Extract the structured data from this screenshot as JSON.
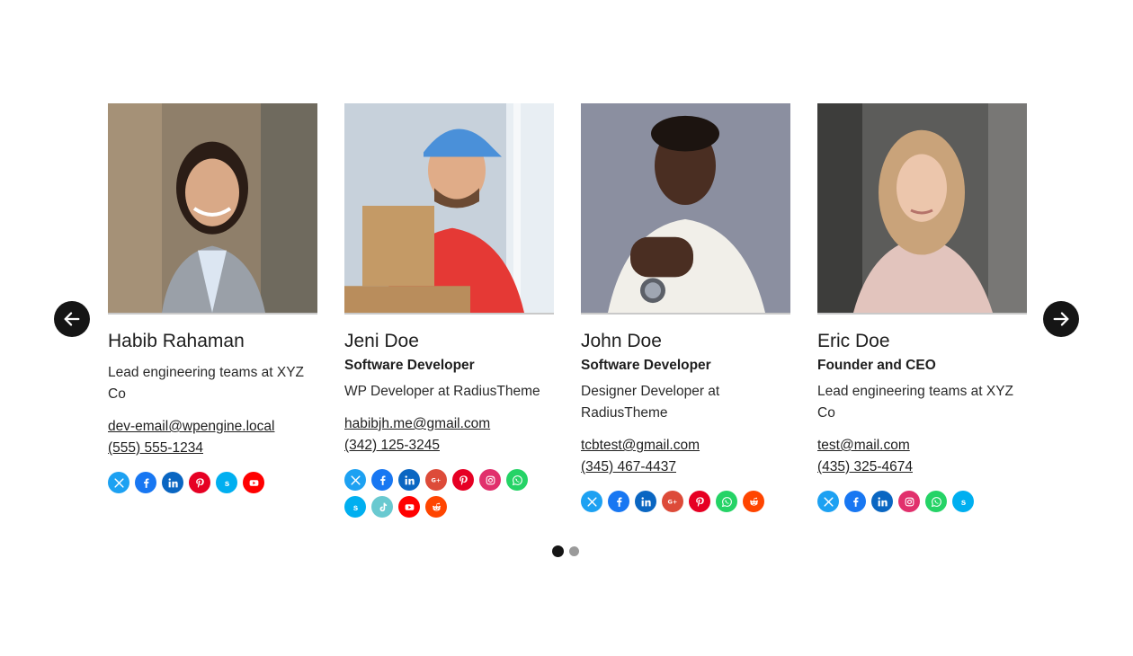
{
  "navigation": {
    "prev_icon": "arrow-left-icon",
    "next_icon": "arrow-right-icon"
  },
  "members": [
    {
      "name": "Habib Rahaman",
      "role": "",
      "bio": "Lead engineering teams at XYZ Co",
      "email": "dev-email@wpengine.local",
      "phone": "(555) 555-1234",
      "socials": [
        "twitter-x",
        "facebook",
        "linkedin",
        "pinterest",
        "skype",
        "youtube"
      ]
    },
    {
      "name": "Jeni Doe",
      "role": "Software Developer",
      "bio": "WP Developer at RadiusTheme",
      "email": "habibjh.me@gmail.com",
      "phone": "(342) 125-3245",
      "socials": [
        "twitter-x",
        "facebook",
        "linkedin",
        "google-plus",
        "pinterest",
        "instagram",
        "whatsapp",
        "skype",
        "tiktok",
        "youtube",
        "reddit"
      ]
    },
    {
      "name": "John Doe",
      "role": "Software Developer",
      "bio": "Designer Developer at RadiusTheme",
      "email": "tcbtest@gmail.com",
      "phone": "(345) 467-4437",
      "socials": [
        "twitter-x",
        "facebook",
        "linkedin",
        "google-plus",
        "pinterest",
        "whatsapp",
        "reddit"
      ]
    },
    {
      "name": "Eric Doe",
      "role": "Founder and CEO",
      "bio": "Lead engineering teams at XYZ Co",
      "email": "test@mail.com",
      "phone": "(435) 325-4674",
      "socials": [
        "twitter-x",
        "facebook",
        "linkedin",
        "instagram",
        "whatsapp",
        "skype"
      ]
    }
  ],
  "pagination": {
    "pages": 2,
    "active": 1
  },
  "social_colors": {
    "twitter-x": "#1da1f2",
    "facebook": "#1877f2",
    "linkedin": "#0a66c2",
    "pinterest": "#e60023",
    "skype": "#00aff0",
    "youtube": "#ff0000",
    "google-plus": "#dd4b39",
    "instagram": "#e1306c",
    "whatsapp": "#25d366",
    "tiktok": "#69c9d0",
    "reddit": "#ff4500"
  }
}
